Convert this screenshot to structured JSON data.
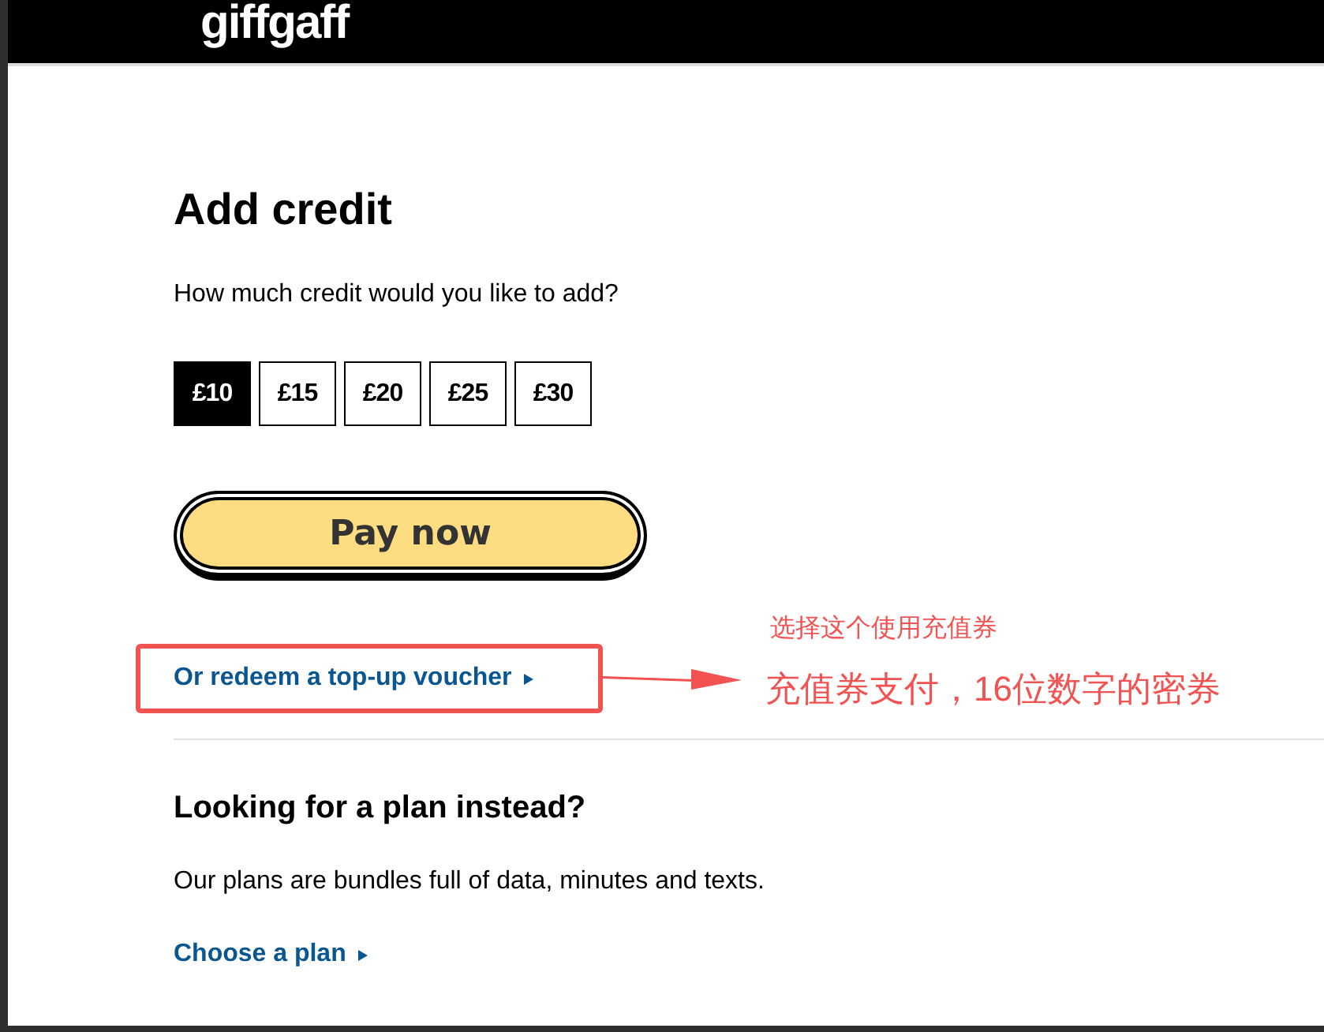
{
  "header": {
    "logo": "giffgaff"
  },
  "top_up": {
    "title": "Add credit",
    "question": "How much credit would you like to add?",
    "amounts": [
      {
        "label": "£10",
        "selected": true
      },
      {
        "label": "£15",
        "selected": false
      },
      {
        "label": "£20",
        "selected": false
      },
      {
        "label": "£25",
        "selected": false
      },
      {
        "label": "£30",
        "selected": false
      }
    ],
    "pay_button": "Pay now",
    "voucher_link": "Or redeem a top-up voucher"
  },
  "annotation": {
    "notes": [
      "选择这个使用充值券",
      "充值券支付，16位数字的密券"
    ]
  },
  "plan_section": {
    "heading": "Looking for a plan instead?",
    "text": "Our plans are bundles full of data, minutes and texts.",
    "link": "Choose a plan"
  }
}
